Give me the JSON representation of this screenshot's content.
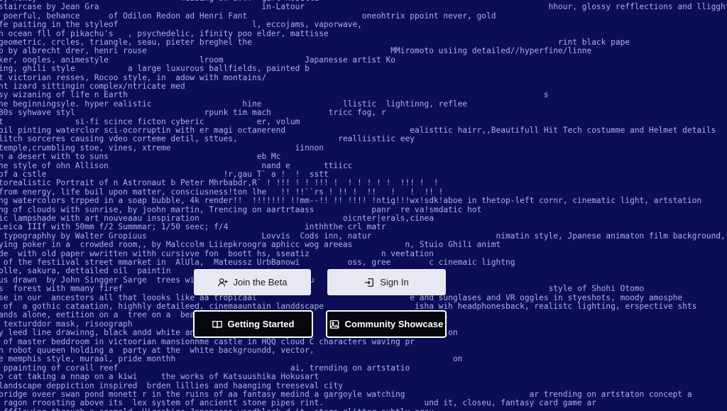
{
  "background_text_lines": [
    "sy honey                              feasing on a... ~gift Rosetti",
    "staircase by Jean Gra                                  in-Latour                                                   hhour, glossy refflections and lligght rays, portals",
    " poerful, behance      of Odilon Redon ad Henri Fant                        oneohtrix ppoint never, gold",
    "fe paiting in the styleof                            l, eccojams, vaporwave,",
    "n ocean fll of pikachu's   , psychedelic, ifinity poo elder, mattisse",
    "geometric, crcles, triangle, seau, pieter breghel the                                                                rint black pape",
    "p by albrecht drer, henri rouse                                                   MMiromoto usiing detailed//hyperfine/linne",
    "ker, oogles, animestyle                   lroom                 Japanesse artist Ko",
    "ing, ghili style           a large luxurous ballfields, painted b",
    "t victorian resses, Rocoo style, in  adow with montains/",
    "nt izard sittingin complex/ntricate med",
    "sy wizaning of life n Earth                                                                                       s",
    "he beginningsyle. hyper ealistic                   hine                 llistic  lightinng, reflee",
    "80s syhwave styl                           rpunk tim mach            tricc fog, r",
    "t               si-fi scince ficton cyberic           er, volum",
    "oil pinting waterclor sci-ocorruptin with er magi octanerend                          ealisttic hairr,,Beautifull Hit Tech costumme and Helmet details",
    "litch sorceres causing vdeo corteme detil, sttues,                     realliistiic eey",
    "temple,crumbling stoe, vines, xtreme                          iinnon",
    "n a desert with to suns                               eb Mc",
    "he style of ohn Allison                                nand e       ttiicc",
    "of a cstle                                     !r,gau T` a !  !  sstt",
    "torealistic Portrait of n Astronaut b Peter Mhrbabdr,R` ! !!! ! ! !!! !  ! ! ! ! !  !!! !  !",
    "from energy, life buil upon matter, consciusness!ton lhe   !! !!``rs ! !! !  !!   !   !  !! !",
    "ng watercolors trpped in a soap bubble, 4k render!!  !!!!!!! !!mm--!! !! !!!! !ntig!!!wx!sdk!aboe in thetop-left cornr, cinematic light, artstation",
    "ng of clouds with sunrise, by joohn martin, Trencing on aartrtaass            panr  re va!smdatic hot",
    "ic lampshade with art nouveaau inspiration                              oicnter|erals,cinea",
    "Leica IIIf with 50mm f/2 Summmar; 1/50 seec; f/4                inthhthe crl matr",
    " typographhy by Walter Gropiuus                        Lovvis  Cods inn, natur                          nimatin style, Jpanese animaton film background,",
    "ying poker in a  crowded room,, by Malccolm Liiepkroogra aphicc wog areeas           n, Stuio Ghili animt",
    "de  with old paper wwritten withh cursivve fon  boott hs, sseatiz               n veetation",
    " of the festiival street mmarket in  AlUla,  Mateussz UrbBanowi          oss, gree        c cinemaic lightng",
    "plle, sakura, dettailed oil  paintin                                                   ",
    "us drawn  by John Singger Sarge  trees wii                      ju",
    "s  forest with mmany firef                                                                                         style of Shohi Otomo",
    "se in our  ancestors all that loooks like aa tropicaal                                e and sunglases and VR oggles in styeshots, moody amosphe",
    " of  a gothic cataation, highhly detaileed, cinemaauntain landdscape                   isha wih headphonesback, realistc lighting, erspective shts",
    "ands alone, eetition on a  tree on a  beau                                            pitch bl",
    " texturddor mask, risoograph                                            ",
    "y leed line drawinng, black andd white and                                            elebration",
    " of master beddroom in victoorian mansionnme castle in HQQ cloud C characters waving pr",
    "n robot quueen holding a  party at the  white backgroundd, vector,",
    "e memphis style, muraal, pride monthh                                                          on",
    " ppainting of corall reef                                    ai, trending on artstatio",
    "o cat taking a nnap on a kiwi     the works of Katsuushika Hokusart",
    "landscape deppiction inspired  brden lillies and haanging treeseval city",
    "bridge oveer swan pond monett r in the ruins of aa fantasy medind a gargoyle watching                          ar trending on artstaton concept a",
    " ragon rroosting above its  lex system of ancientt stone pipes rint.                     und it, closeu, fantasy card game ar",
    " ffflowing through a coomeld  Hiroshige Japaneese woodblock d it  stars glitter subtly arou"
  ],
  "buttons": {
    "join_beta": {
      "label": "Join the Beta",
      "icon": "add-user-icon"
    },
    "sign_in": {
      "label": "Sign In",
      "icon": "sign-in-icon"
    },
    "getting_started": {
      "label": "Getting Started",
      "icon": "book-icon"
    },
    "community_showcase": {
      "label": "Community Showcase",
      "icon": "image-icon"
    }
  },
  "colors": {
    "background": "#0b0d55",
    "background_text": "#a9b2e8",
    "light_button": "#e8e8f3",
    "dark_button": "#06070f"
  }
}
